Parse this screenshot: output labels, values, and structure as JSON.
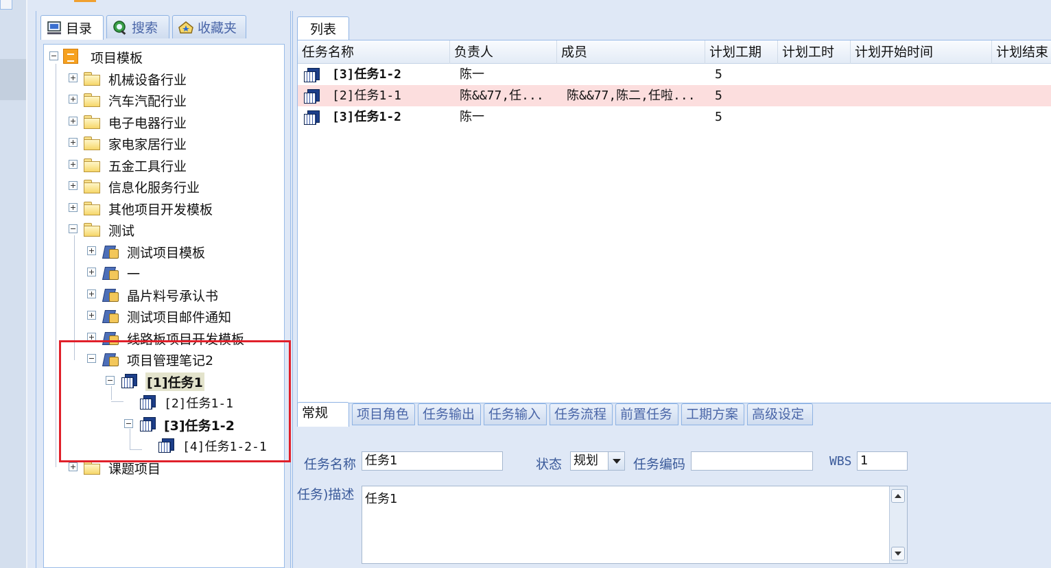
{
  "tree_tabs": [
    {
      "label": "目录",
      "icon": "computer-icon"
    },
    {
      "label": "搜索",
      "icon": "search-icon"
    },
    {
      "label": "收藏夹",
      "icon": "favorites-icon"
    }
  ],
  "tree": {
    "root": "项目模板",
    "folders": [
      "机械设备行业",
      "汽车汽配行业",
      "电子电器行业",
      "家电家居行业",
      "五金工具行业",
      "信息化服务行业",
      "其他项目开发模板",
      "测试"
    ],
    "test_children": [
      "测试项目模板",
      "一",
      "晶片料号承认书",
      "测试项目邮件通知",
      "线路板项目开发模板",
      "项目管理笔记2"
    ],
    "tasks": [
      "[1]任务1",
      "[2]任务1-1",
      "[3]任务1-2",
      "[4]任务1-2-1"
    ],
    "last_folder": "课题项目"
  },
  "list_tab": "列表",
  "grid": {
    "headers": [
      "任务名称",
      "负责人",
      "成员",
      "计划工期",
      "计划工时",
      "计划开始时间",
      "计划结束"
    ],
    "rows": [
      {
        "name": "[3]任务1-2",
        "owner": "陈一",
        "members": "",
        "duration": "5",
        "bold": true
      },
      {
        "name": "[2]任务1-1",
        "owner": "陈&&77,任...",
        "members": "陈&&77,陈二,任啦...",
        "duration": "5",
        "bold": false
      },
      {
        "name": "[3]任务1-2",
        "owner": "陈一",
        "members": "",
        "duration": "5",
        "bold": true
      }
    ]
  },
  "detail_tabs": [
    "常规",
    "项目角色",
    "任务输出",
    "任务输入",
    "任务流程",
    "前置任务",
    "工期方案",
    "高级设定"
  ],
  "form": {
    "task_name_label": "任务名称",
    "task_name_value": "任务1",
    "status_label": "状态",
    "status_value": "规划",
    "task_code_label": "任务编码",
    "task_code_value": "",
    "wbs_label": "WBS",
    "wbs_value": "1",
    "desc_label": "任务)描述",
    "desc_value": "任务1"
  },
  "colors": {
    "highlight": "#e0202a",
    "selected_row": "#fcdede"
  }
}
